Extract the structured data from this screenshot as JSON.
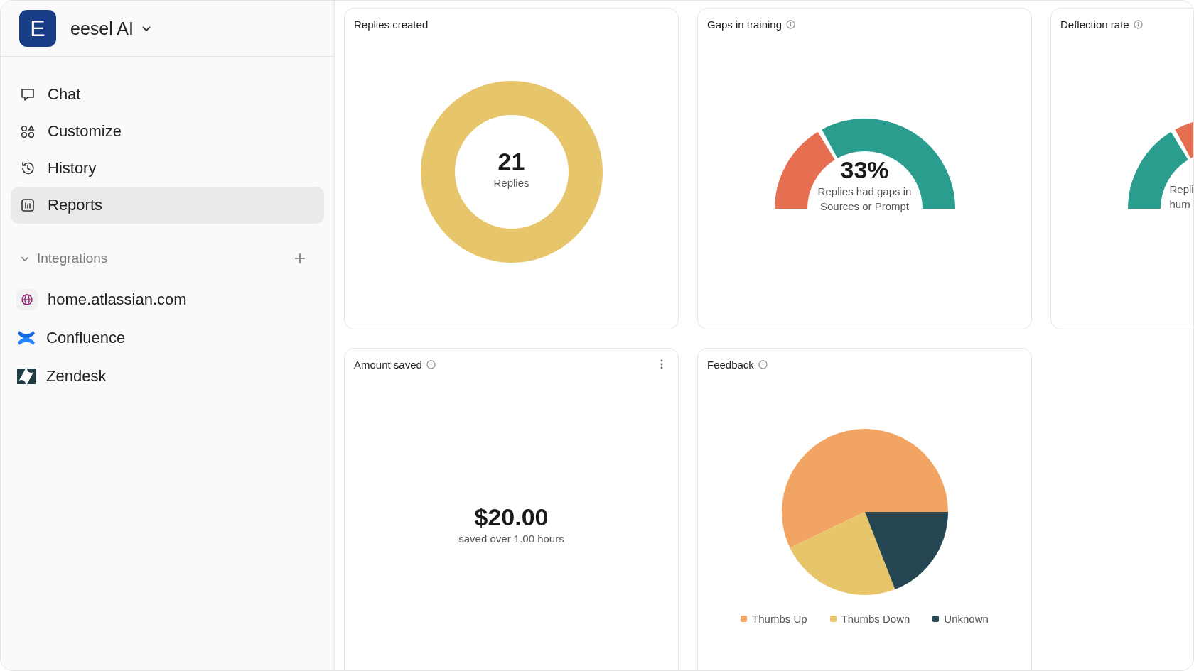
{
  "workspace": {
    "initial": "E",
    "name": "eesel AI"
  },
  "nav": [
    {
      "label": "Chat",
      "selected": false
    },
    {
      "label": "Customize",
      "selected": false
    },
    {
      "label": "History",
      "selected": false
    },
    {
      "label": "Reports",
      "selected": true
    }
  ],
  "integrations": {
    "title": "Integrations",
    "expanded": true,
    "items": [
      {
        "label": "home.atlassian.com"
      },
      {
        "label": "Confluence"
      },
      {
        "label": "Zendesk"
      }
    ]
  },
  "cards": [
    {
      "kind": "donut",
      "title": "Replies created",
      "value": "21",
      "caption": "Replies"
    },
    {
      "kind": "gauge",
      "title": "Gaps in training",
      "info": true,
      "reversed": false,
      "clipped": false,
      "value": "33%",
      "caption": [
        "Replies had gaps in",
        "Sources or Prompt"
      ]
    },
    {
      "kind": "gauge",
      "title": "Deflection rate",
      "info": true,
      "reversed": true,
      "clipped": true,
      "caption": [
        "Repli",
        "hum"
      ]
    },
    {
      "kind": "amount",
      "title": "Amount saved",
      "info": true,
      "menu": true,
      "value": "$20.00",
      "caption": "saved over 1.00 hours"
    },
    {
      "kind": "pie",
      "title": "Feedback",
      "info": true,
      "chart_data": {
        "type": "pie",
        "categories": [
          "Thumbs Up",
          "Thumbs Down",
          "Unknown"
        ],
        "values": [
          57.1,
          23.8,
          19.1
        ],
        "legend": "bottom",
        "colors": [
          "#f2a462",
          "#e7c56a",
          "#264653"
        ]
      }
    }
  ]
}
